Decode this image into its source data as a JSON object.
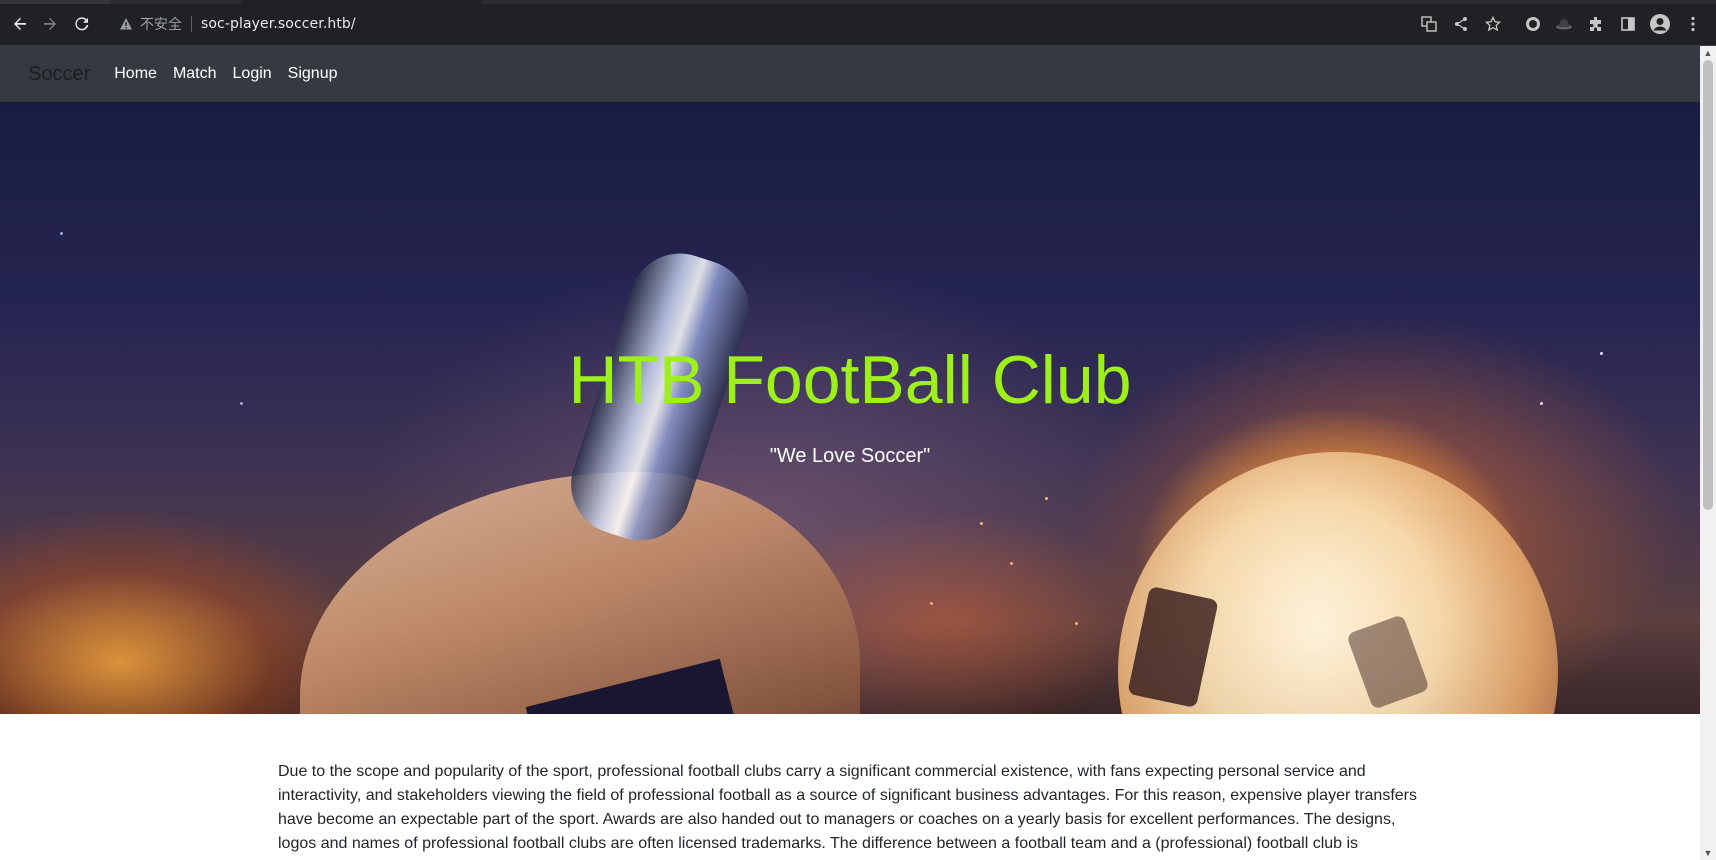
{
  "browser": {
    "security_text": "不安全",
    "url": "soc-player.soccer.htb/",
    "icons": [
      "back-icon",
      "forward-icon",
      "reload-icon",
      "warning-icon",
      "translate-icon",
      "share-icon",
      "star-icon",
      "extension-circle-icon",
      "extension-hat-icon",
      "puzzle-icon",
      "sidepanel-icon",
      "profile-icon",
      "more-icon"
    ]
  },
  "navbar": {
    "brand": "Soccer",
    "links": [
      "Home",
      "Match",
      "Login",
      "Signup"
    ]
  },
  "hero": {
    "title": "HTB FootBall Club",
    "subtitle": "\"We Love Soccer\""
  },
  "content": {
    "paragraph": "Due to the scope and popularity of the sport, professional football clubs carry a significant commercial existence, with fans expecting personal service and interactivity, and stakeholders viewing the field of professional football as a source of significant business advantages. For this reason, expensive player transfers have become an expectable part of the sport. Awards are also handed out to managers or coaches on a yearly basis for excellent performances. The designs, logos and names of professional football clubs are often licensed trademarks. The difference between a football team and a (professional) football club is"
  },
  "colors": {
    "navbar_bg": "#343a40",
    "title_color": "#9ef01a",
    "chrome_bg": "#202124"
  }
}
